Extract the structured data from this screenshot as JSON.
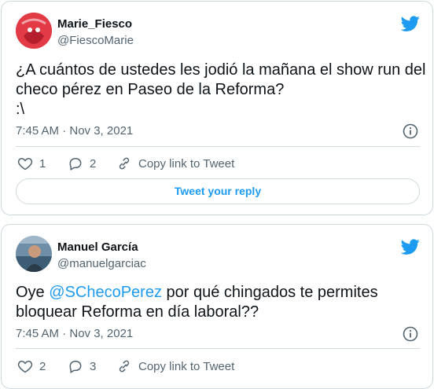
{
  "tweets": [
    {
      "name": "Marie_Fiesco",
      "handle": "@FiescoMarie",
      "text_lines": [
        "¿A cuántos de ustedes les jodió la mañana el show run del",
        "checo pérez en Paseo de la Reforma?",
        ":\\"
      ],
      "timestamp": "7:45 AM · Nov 3, 2021",
      "likes": "1",
      "replies": "2",
      "copy_link_label": "Copy link to Tweet",
      "reply_button_label": "Tweet your reply"
    },
    {
      "name": "Manuel García",
      "handle": "@manuelgarciac",
      "text_before_mention": "Oye ",
      "mention": "@SChecoPerez",
      "text_after_mention": " por qué chingados te permites",
      "text_line2": "bloquear Reforma en día laboral??",
      "timestamp": "7:45 AM · Nov 3, 2021",
      "likes": "2",
      "replies": "3",
      "copy_link_label": "Copy link to Tweet"
    }
  ],
  "colors": {
    "accent": "#1d9bf0",
    "text": "#0f1419",
    "secondary": "#536471",
    "border": "#cfd9de"
  },
  "icons": [
    "twitter-bird-icon",
    "info-icon",
    "heart-icon",
    "reply-bubble-icon",
    "link-icon"
  ]
}
